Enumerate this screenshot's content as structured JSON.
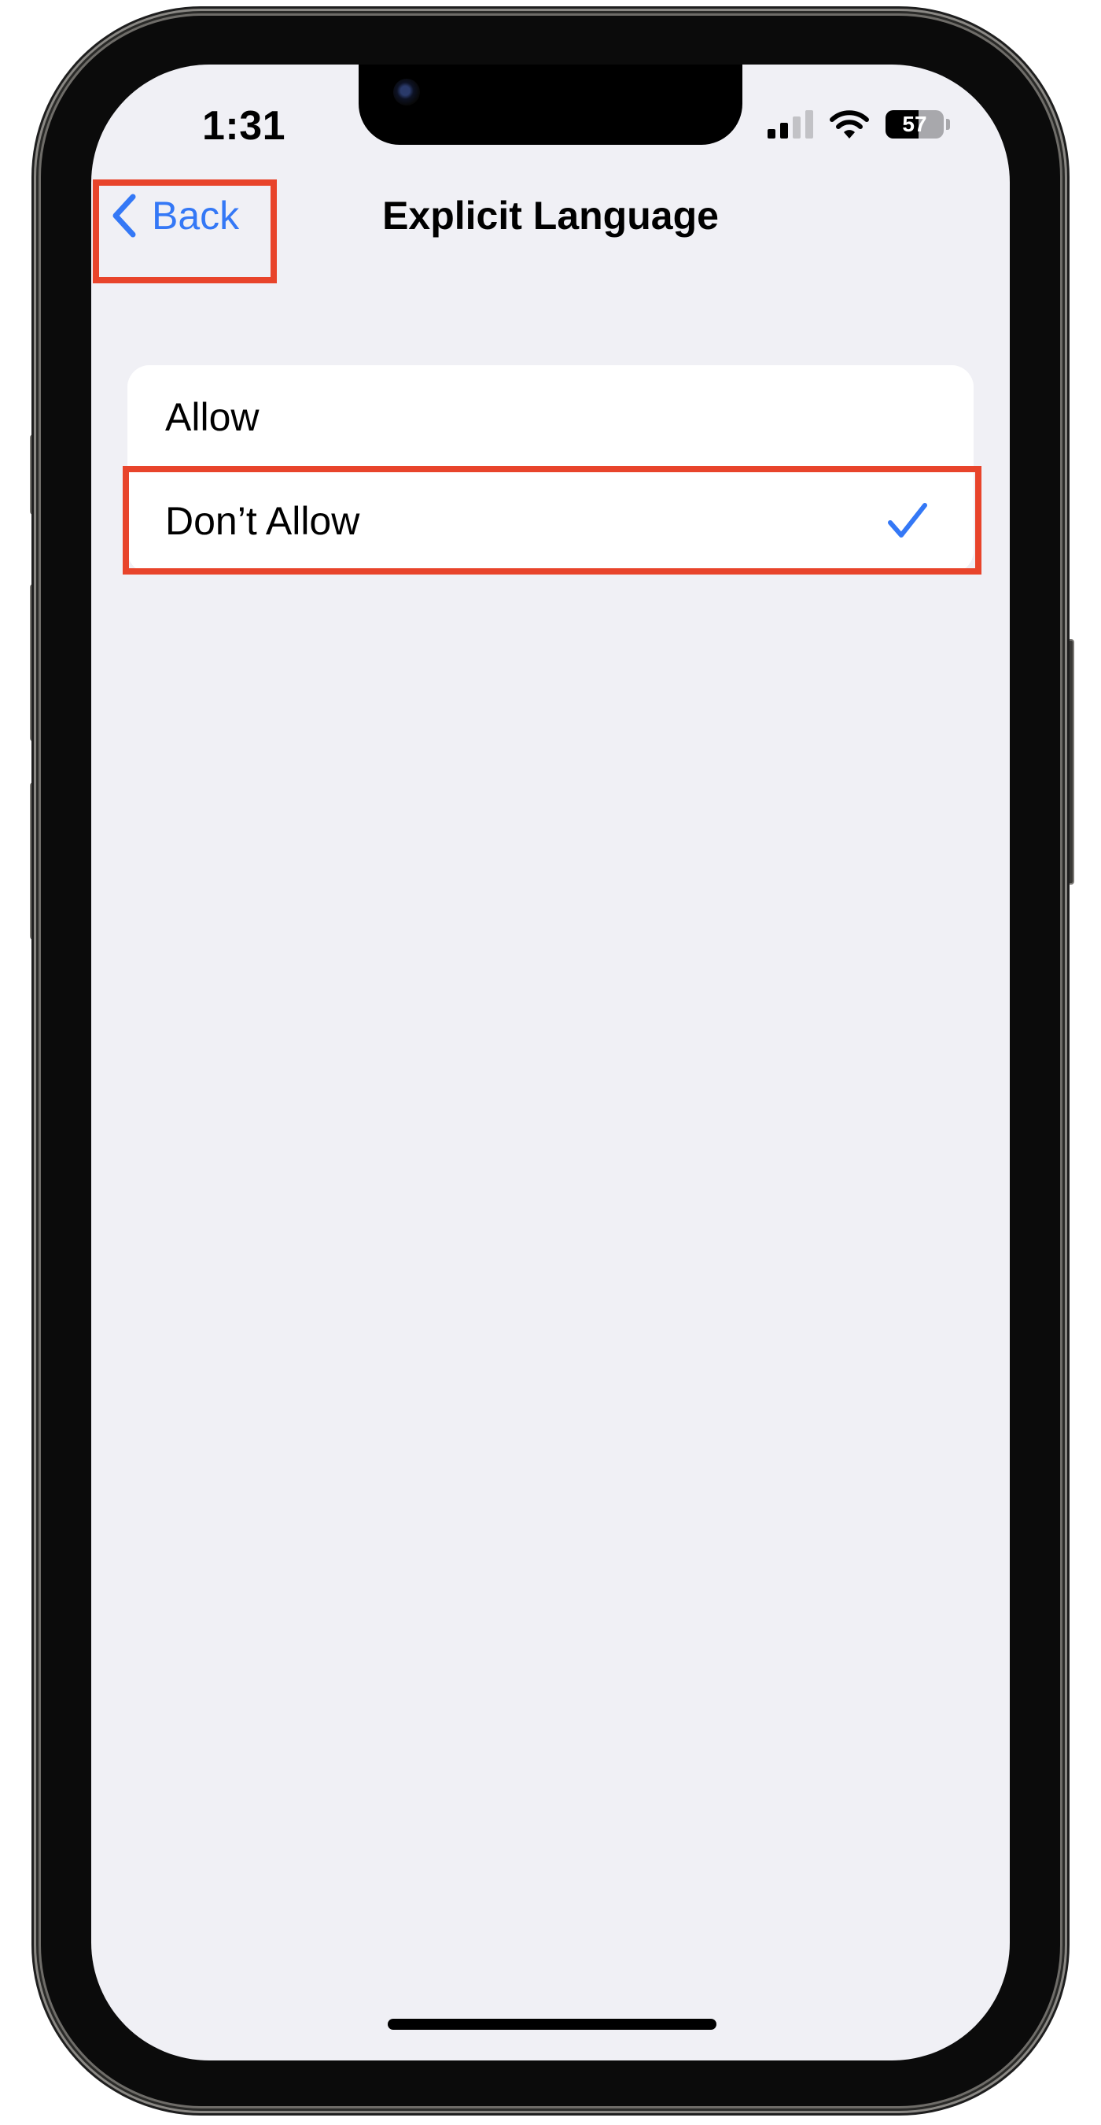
{
  "status_bar": {
    "time": "1:31",
    "battery_text": "57",
    "battery_level_percent": 57,
    "signal_bars_active": 2,
    "signal_bars_total": 4
  },
  "nav": {
    "back_label": "Back",
    "title": "Explicit Language"
  },
  "options": [
    {
      "label": "Allow",
      "selected": false
    },
    {
      "label": "Don’t Allow",
      "selected": true
    }
  ],
  "colors": {
    "accent": "#3478f6",
    "background": "#f0f0f5",
    "highlight": "#e8442b"
  },
  "icons": {
    "back": "chevron-left-icon",
    "selected": "checkmark-icon",
    "wifi": "wifi-icon",
    "signal": "cellular-signal-icon",
    "battery": "battery-icon"
  }
}
